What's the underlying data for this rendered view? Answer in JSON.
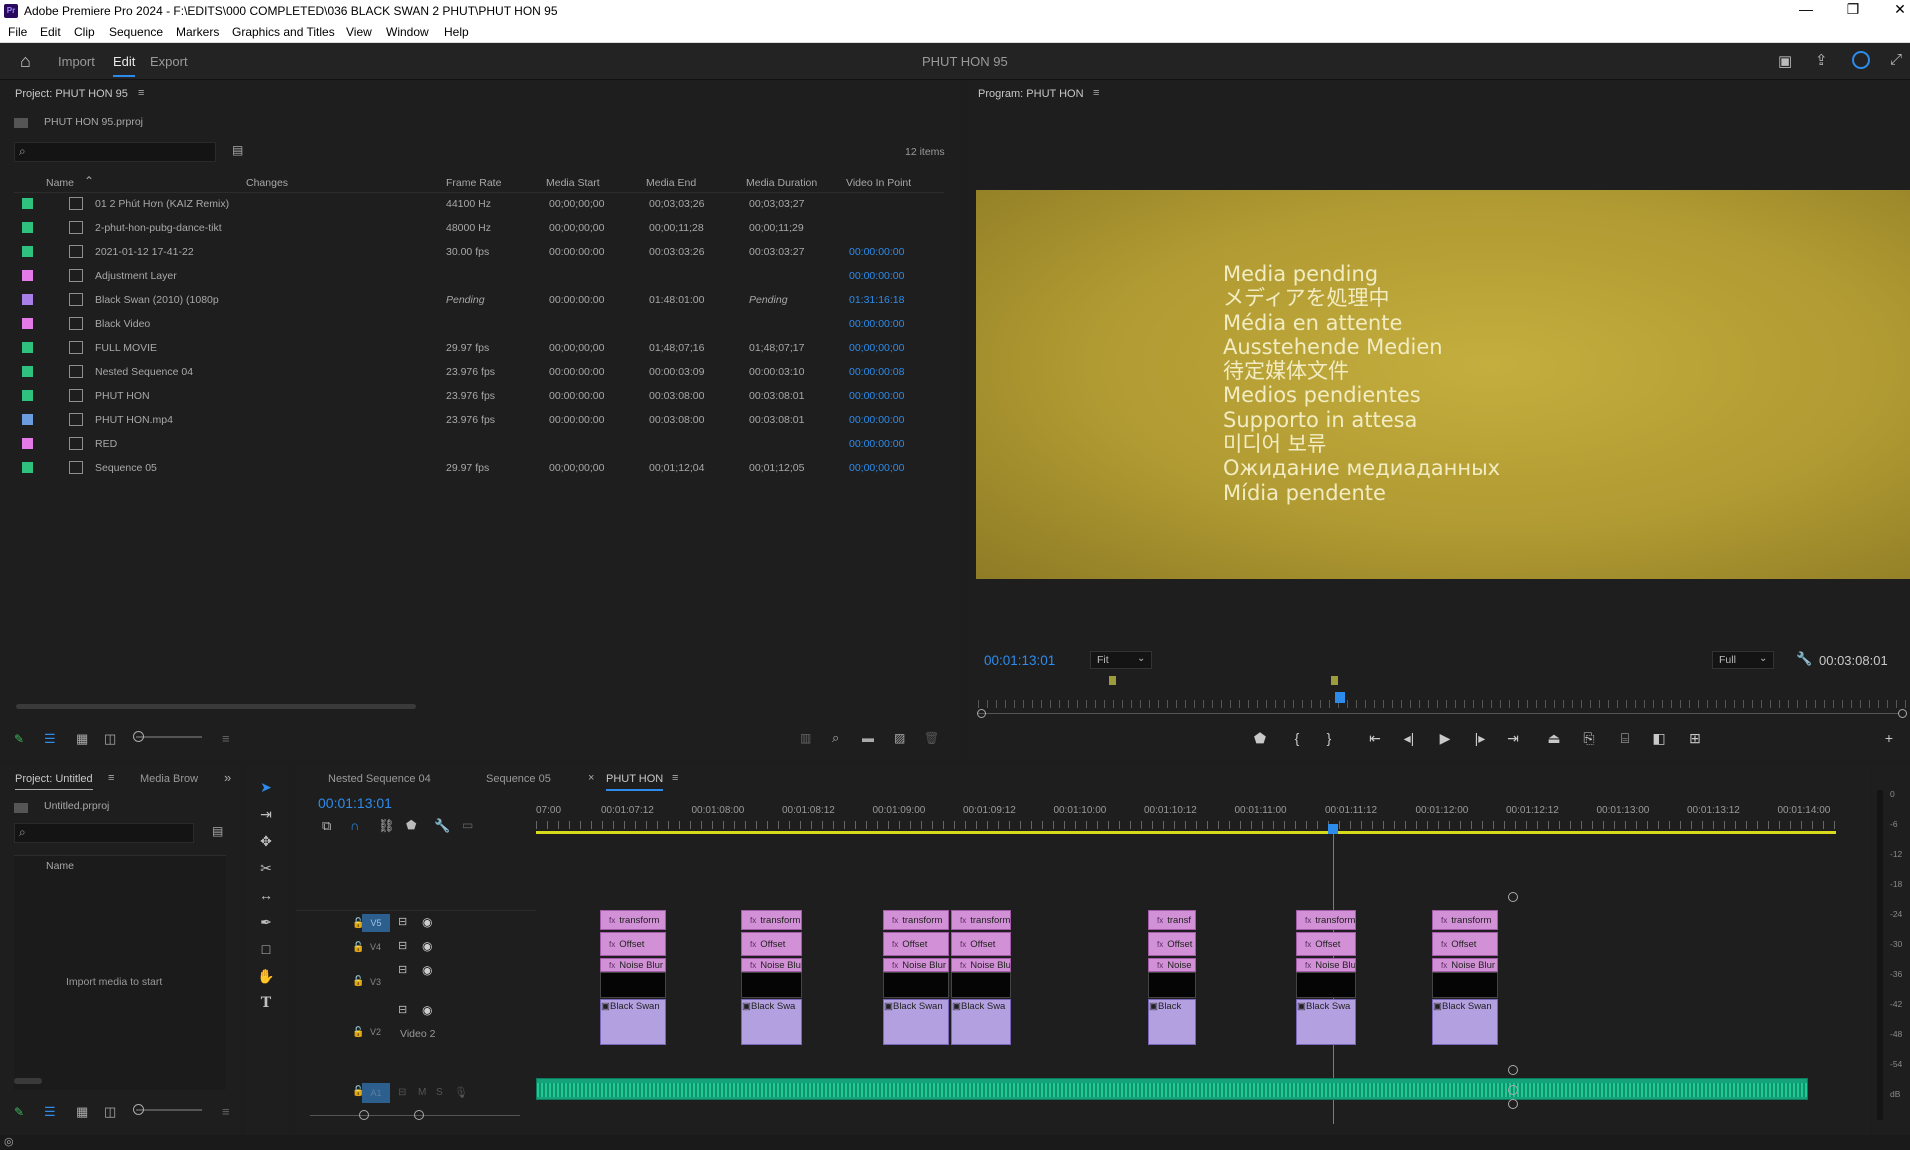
{
  "window": {
    "app_icon": "Pr",
    "title": "Adobe Premiere Pro 2024 - F:\\EDITS\\000 COMPLETED\\036 BLACK SWAN 2 PHUT\\PHUT HON 95"
  },
  "menu": [
    "File",
    "Edit",
    "Clip",
    "Sequence",
    "Markers",
    "Graphics and Titles",
    "View",
    "Window",
    "Help"
  ],
  "header": {
    "workspaces": [
      "Import",
      "Edit",
      "Export"
    ],
    "active_workspace": "Edit",
    "project_title": "PHUT HON 95"
  },
  "project_panel": {
    "title": "Project: PHUT HON 95",
    "file": "PHUT HON 95.prproj",
    "item_count": "12 items",
    "columns": [
      "Name",
      "Changes",
      "Frame Rate",
      "Media Start",
      "Media End",
      "Media Duration",
      "Video In Point"
    ],
    "rows": [
      {
        "color": "#2ec27e",
        "icon": "audio-icon",
        "name": "01 2 Phút Hơn (KAIZ Remix)",
        "frame_rate": "44100 Hz",
        "media_start": "00;00;00;00",
        "media_end": "00;03;03;26",
        "duration": "00;03;03;27",
        "in_point": ""
      },
      {
        "color": "#2ec27e",
        "icon": "file-icon",
        "name": "2-phut-hon-pubg-dance-tikt",
        "frame_rate": "48000 Hz",
        "media_start": "00;00;00;00",
        "media_end": "00;00;11;28",
        "duration": "00;00;11;29",
        "in_point": ""
      },
      {
        "color": "#2ec27e",
        "icon": "sequence-icon",
        "name": "2021-01-12 17-41-22",
        "frame_rate": "30.00 fps",
        "media_start": "00:00:00:00",
        "media_end": "00:03:03:26",
        "duration": "00:03:03:27",
        "in_point": "00:00:00:00"
      },
      {
        "color": "#e47ae6",
        "icon": "adjustment-layer-icon",
        "name": "Adjustment Layer",
        "frame_rate": "",
        "media_start": "",
        "media_end": "",
        "duration": "",
        "in_point": "00:00:00:00"
      },
      {
        "color": "#a97ee6",
        "icon": "file-icon",
        "name": "Black Swan (2010) (1080p",
        "frame_rate": "Pending",
        "media_start": "00:00:00:00",
        "media_end": "01:48:01:00",
        "duration": "Pending",
        "in_point": "01:31:16:18"
      },
      {
        "color": "#e47ae6",
        "icon": "adjustment-layer-icon",
        "name": "Black Video",
        "frame_rate": "",
        "media_start": "",
        "media_end": "",
        "duration": "",
        "in_point": "00:00:00:00"
      },
      {
        "color": "#2ec27e",
        "icon": "sequence-icon",
        "name": "FULL MOVIE",
        "frame_rate": "29.97 fps",
        "media_start": "00;00;00;00",
        "media_end": "01;48;07;16",
        "duration": "01;48;07;17",
        "in_point": "00;00;00;00"
      },
      {
        "color": "#2ec27e",
        "icon": "sequence-icon",
        "name": "Nested Sequence 04",
        "frame_rate": "23.976 fps",
        "media_start": "00:00:00:00",
        "media_end": "00:00:03:09",
        "duration": "00:00:03:10",
        "in_point": "00:00:00:08"
      },
      {
        "color": "#2ec27e",
        "icon": "sequence-icon",
        "name": "PHUT HON",
        "frame_rate": "23.976 fps",
        "media_start": "00:00:00:00",
        "media_end": "00:03:08:00",
        "duration": "00:03:08:01",
        "in_point": "00:00:00:00"
      },
      {
        "color": "#6c9ce0",
        "icon": "video-file-icon",
        "name": "PHUT HON.mp4",
        "frame_rate": "23.976 fps",
        "media_start": "00:00:00:00",
        "media_end": "00:03:08:00",
        "duration": "00:03:08:01",
        "in_point": "00:00:00:00"
      },
      {
        "color": "#e47ae6",
        "icon": "adjustment-layer-icon",
        "name": "RED",
        "frame_rate": "",
        "media_start": "",
        "media_end": "",
        "duration": "",
        "in_point": "00:00:00:00"
      },
      {
        "color": "#2ec27e",
        "icon": "sequence-icon",
        "name": "Sequence 05",
        "frame_rate": "29.97 fps",
        "media_start": "00;00;00;00",
        "media_end": "00;01;12;04",
        "duration": "00;01;12;05",
        "in_point": "00;00;00;00"
      }
    ]
  },
  "program_monitor": {
    "title": "Program: PHUT HON",
    "pending_lines": [
      "Media pending",
      "メディアを処理中",
      "Média en attente",
      "Ausstehende Medien",
      "待定媒体文件",
      "Medios pendientes",
      "Supporto in attesa",
      "미디어 보류",
      "Ожидание медиаданных",
      "Mídia pendente"
    ],
    "timecode": "00:01:13:01",
    "fit": "Fit",
    "quality": "Full",
    "duration": "00:03:08:01",
    "controls": [
      "marker-icon",
      "mark-in-icon",
      "mark-out-icon",
      "go-to-in-icon",
      "step-back-icon",
      "play-icon",
      "step-forward-icon",
      "go-to-out-icon",
      "lift-icon",
      "extract-icon",
      "export-frame-icon",
      "compare-icon",
      "multicam-icon",
      "add-button-icon"
    ]
  },
  "small_project": {
    "tabs": [
      "Project: Untitled",
      "Media Brow"
    ],
    "file": "Untitled.prproj",
    "column": "Name",
    "empty_text": "Import media to start"
  },
  "timeline": {
    "tabs": [
      "Nested Sequence 04",
      "Sequence 05",
      "PHUT HON"
    ],
    "active_tab": "PHUT HON",
    "timecode": "00:01:13:01",
    "ruler": [
      "07:00",
      "00:01:07:12",
      "00:01:08:00",
      "00:01:08:12",
      "00:01:09:00",
      "00:01:09:12",
      "00:01:10:00",
      "00:01:10:12",
      "00:01:11:00",
      "00:01:11:12",
      "00:01:12:00",
      "00:01:12:12",
      "00:01:13:00",
      "00:01:13:12",
      "00:01:14:00"
    ],
    "tracks": [
      "V5",
      "V4",
      "V3",
      "V2",
      "A1"
    ],
    "track_name_v2": "Video 2",
    "clip_labels": {
      "v5": [
        "transform",
        "transform",
        "transform",
        "transform",
        "transf",
        "transform",
        "transform"
      ],
      "v4": [
        "Offset",
        "Offset",
        "Offset",
        "Offset",
        "Offset",
        "Offset",
        "Offset"
      ],
      "v3": [
        "Noise Blur",
        "Noise Blur",
        "Noise Blur",
        "Noise Blur",
        "Noise",
        "Noise Blur",
        "Noise Blur"
      ],
      "v2": [
        "Black Swan",
        "Black Swa",
        "Black Swan",
        "Black Swa",
        "Black",
        "Black Swa",
        "Black Swan"
      ]
    },
    "meter_labels": [
      "0",
      "-6",
      "-12",
      "-18",
      "-24",
      "-30",
      "-36",
      "-42",
      "-48",
      "-54",
      "dB"
    ]
  },
  "colors": {
    "accent": "#2d8ceb",
    "effect_clip": "#d291d6",
    "video_clip": "#b3a0e0",
    "audio_clip": "#1fb788"
  }
}
